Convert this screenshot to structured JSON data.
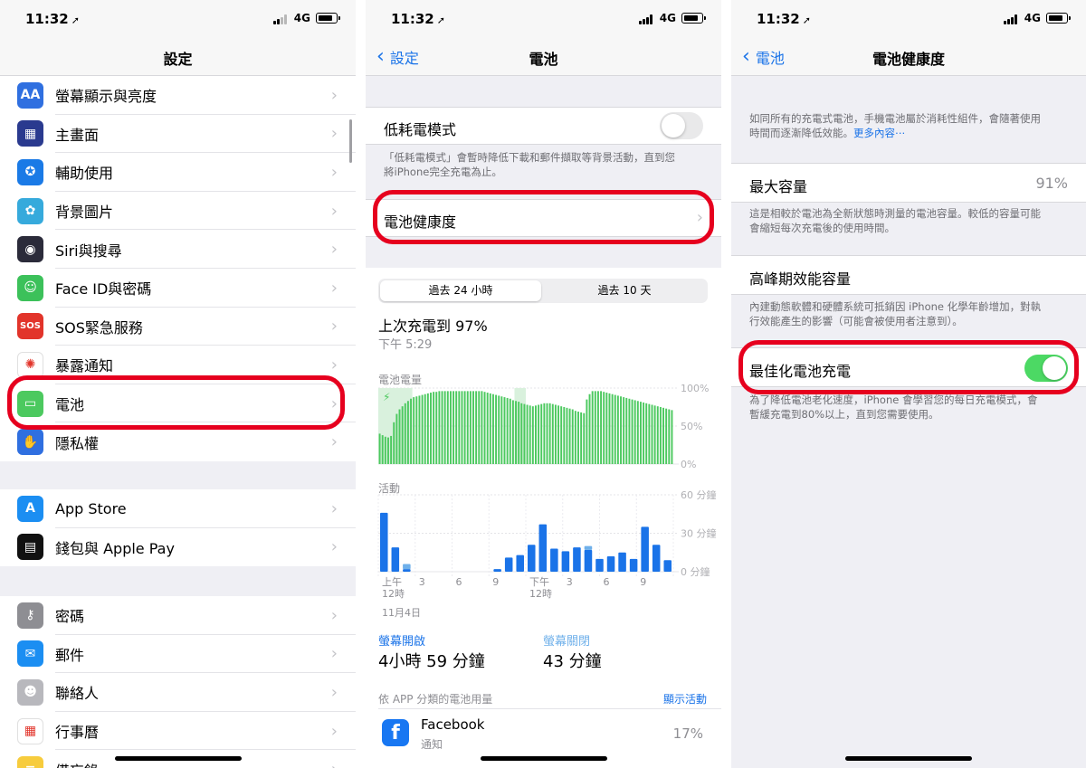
{
  "status_bar": {
    "time": "11:32",
    "location_glyph": "➚",
    "network": "4G"
  },
  "screen1": {
    "title": "設定",
    "group1": [
      {
        "label": "螢幕顯示與亮度",
        "icon": "display-brightness-icon",
        "icon_text": "AA",
        "color": "#2f6fe0"
      },
      {
        "label": "主畫面",
        "icon": "home-screen-icon",
        "color": "#2a3a8f"
      },
      {
        "label": "輔助使用",
        "icon": "accessibility-icon",
        "color": "#1a7ae6"
      },
      {
        "label": "背景圖片",
        "icon": "wallpaper-icon",
        "color": "#36aadc"
      },
      {
        "label": "Siri與搜尋",
        "icon": "siri-icon",
        "color": "#2b2b3a"
      },
      {
        "label": "Face ID與密碼",
        "icon": "face-id-icon",
        "color": "#3cc15a"
      },
      {
        "label": "SOS緊急服務",
        "icon": "sos-icon",
        "icon_text": "SOS",
        "color": "#e2342a"
      },
      {
        "label": "暴露通知",
        "icon": "exposure-notification-icon",
        "color": "#ffffff"
      },
      {
        "label": "電池",
        "icon": "battery-icon",
        "color": "#4cc95f"
      },
      {
        "label": "隱私權",
        "icon": "privacy-hand-icon",
        "color": "#2f6fe0"
      }
    ],
    "group2": [
      {
        "label": "App Store",
        "icon": "app-store-icon",
        "color": "#1b8ef2"
      },
      {
        "label": "錢包與 Apple Pay",
        "icon": "wallet-icon",
        "color": "#111111"
      }
    ],
    "group3": [
      {
        "label": "密碼",
        "icon": "key-icon",
        "color": "#8e8e93"
      },
      {
        "label": "郵件",
        "icon": "mail-icon",
        "color": "#1b8ef2"
      },
      {
        "label": "聯絡人",
        "icon": "contacts-icon",
        "color": "#b8b8bd"
      },
      {
        "label": "行事曆",
        "icon": "calendar-icon",
        "color": "#ffffff"
      },
      {
        "label": "備忘錄",
        "icon": "notes-icon",
        "color": "#f7cc3d"
      }
    ]
  },
  "screen2": {
    "back": "設定",
    "title": "電池",
    "low_power_label": "低耗電模式",
    "low_power_on": false,
    "low_power_footer_1": "「低耗電模式」會暫時降低下載和郵件擷取等背景活動，直到您",
    "low_power_footer_2": "將iPhone完全充電為止。",
    "health_label": "電池健康度",
    "seg_24h": "過去 24 小時",
    "seg_10d": "過去 10 天",
    "last_charge": "上次充電到 97%",
    "last_charge_time": "下午 5:29",
    "level_label": "電池電量",
    "level_ticks": [
      "100%",
      "50%",
      "0%"
    ],
    "activity_label": "活動",
    "activity_ticks": [
      "60 分鐘",
      "30 分鐘",
      "0 分鐘"
    ],
    "x_labels": [
      "上午",
      "3",
      "6",
      "9",
      "下午",
      "3",
      "6",
      "9"
    ],
    "x_sub": [
      "12時",
      "",
      "",
      "",
      "12時",
      "",
      "",
      ""
    ],
    "date_label": "11月4日",
    "screen_on_label": "螢幕開啟",
    "screen_on_value": "4小時 59 分鐘",
    "screen_off_label": "螢幕關閉",
    "screen_off_value": "43 分鐘",
    "by_app_label": "依 APP 分類的電池用量",
    "show_activity": "顯示活動",
    "app_name": "Facebook",
    "app_sub": "通知",
    "app_pct": "17%"
  },
  "chart_data": [
    {
      "type": "bar",
      "title": "電池電量",
      "ylim": [
        0,
        100
      ],
      "y_ticks": [
        "100%",
        "50%",
        "0%"
      ],
      "charging_ranges": [
        [
          0,
          12
        ],
        [
          48,
          52
        ]
      ],
      "values": [
        40,
        38,
        36,
        35,
        37,
        55,
        66,
        72,
        76,
        80,
        83,
        86,
        88,
        89,
        90,
        91,
        92,
        93,
        94,
        95,
        95,
        96,
        96,
        96,
        96,
        96,
        96,
        96,
        96,
        96,
        96,
        96,
        96,
        96,
        96,
        96,
        96,
        95,
        94,
        93,
        92,
        91,
        90,
        89,
        88,
        87,
        86,
        84,
        83,
        82,
        80,
        79,
        78,
        77,
        76,
        77,
        78,
        79,
        80,
        80,
        80,
        79,
        78,
        77,
        76,
        75,
        74,
        73,
        72,
        70,
        69,
        68,
        67,
        85,
        92,
        96,
        96,
        96,
        96,
        95,
        94,
        93,
        92,
        91,
        90,
        89,
        88,
        87,
        86,
        85,
        84,
        83,
        82,
        81,
        80,
        79,
        78,
        77,
        76,
        75,
        74,
        73,
        72,
        71
      ]
    },
    {
      "type": "bar",
      "title": "活動",
      "ylim": [
        0,
        60
      ],
      "y_ticks": [
        "60 分鐘",
        "30 分鐘",
        "0 分鐘"
      ],
      "series": [
        {
          "name": "on",
          "values": [
            46,
            19,
            2,
            0,
            0,
            0,
            0,
            0,
            0,
            0,
            2,
            11,
            13,
            21,
            37,
            18,
            16,
            19,
            17,
            10,
            12,
            15,
            10,
            35,
            21,
            9
          ]
        },
        {
          "name": "off",
          "values": [
            0,
            0,
            4,
            0,
            0,
            0,
            0,
            0,
            0,
            0,
            0,
            0,
            0,
            0,
            0,
            0,
            0,
            0,
            3,
            0,
            0,
            0,
            0,
            0,
            0,
            0
          ]
        }
      ]
    }
  ],
  "screen3": {
    "back": "電池",
    "title": "電池健康度",
    "intro": "如同所有的充電式電池，手機電池屬於消耗性組件，會隨著使用",
    "intro_2": "時間而逐漸降低效能。",
    "more_link": "更多內容⋯",
    "max_label": "最大容量",
    "max_value": "91%",
    "max_footer": "這是相較於電池為全新狀態時測量的電池容量。較低的容量可能",
    "max_footer_2": "會縮短每次充電後的使用時間。",
    "peak_label": "高峰期效能容量",
    "peak_footer": "內建動態軟體和硬體系統可抵銷因 iPhone 化學年齡增加，對執",
    "peak_footer_2": "行效能產生的影響（可能會被使用者注意到）。",
    "opt_label": "最佳化電池充電",
    "opt_on": true,
    "opt_footer": "為了降低電池老化速度，iPhone 會學習您的每日充電模式，會",
    "opt_footer_2": "暫緩充電到80%以上，直到您需要使用。"
  }
}
